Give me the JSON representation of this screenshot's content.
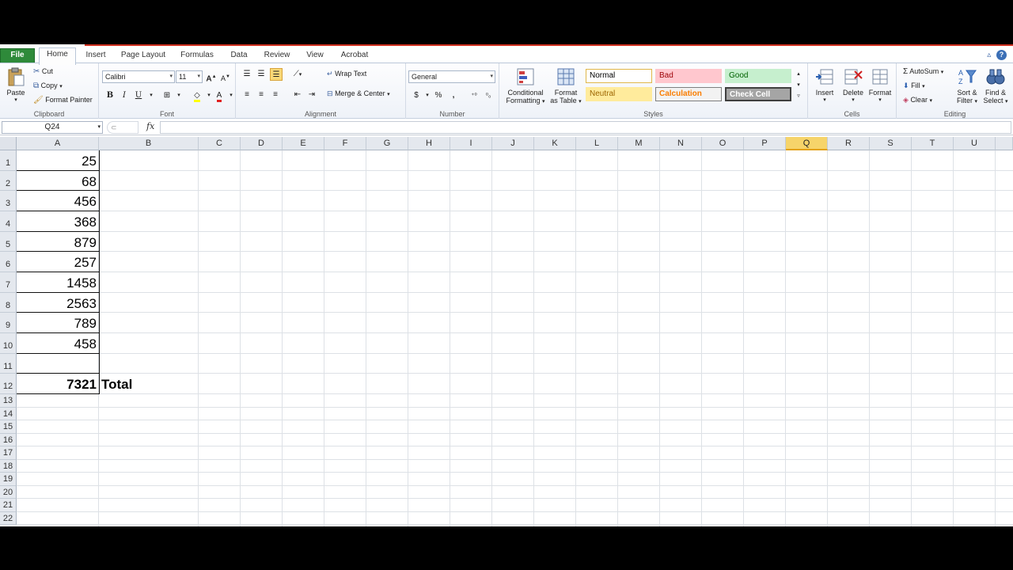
{
  "tabs": [
    "File",
    "Home",
    "Insert",
    "Page Layout",
    "Formulas",
    "Data",
    "Review",
    "View",
    "Acrobat"
  ],
  "clipboard": {
    "paste": "Paste",
    "cut": "Cut",
    "copy": "Copy",
    "format_painter": "Format Painter",
    "label": "Clipboard"
  },
  "font": {
    "name": "Calibri",
    "size": "11",
    "bold": "B",
    "italic": "I",
    "underline": "U",
    "color_letter": "A",
    "label": "Font"
  },
  "alignment": {
    "wrap": "Wrap Text",
    "merge": "Merge & Center",
    "label": "Alignment"
  },
  "number": {
    "format": "General",
    "currency": "$",
    "percent": "%",
    "comma": ",",
    "label": "Number"
  },
  "styles": {
    "conditional_1": "Conditional",
    "conditional_2": "Formatting",
    "format_table_1": "Format",
    "format_table_2": "as Table",
    "normal": "Normal",
    "bad": "Bad",
    "good": "Good",
    "neutral": "Neutral",
    "calculation": "Calculation",
    "check_cell": "Check Cell",
    "label": "Styles"
  },
  "cells": {
    "insert": "Insert",
    "delete": "Delete",
    "format": "Format",
    "label": "Cells"
  },
  "editing": {
    "autosum": "AutoSum",
    "fill": "Fill",
    "clear": "Clear",
    "sort_1": "Sort &",
    "sort_2": "Filter",
    "find_1": "Find &",
    "find_2": "Select",
    "label": "Editing"
  },
  "formula_bar": {
    "name_box": "Q24",
    "fx": "fx",
    "content": ""
  },
  "columns": [
    "A",
    "B",
    "C",
    "D",
    "E",
    "F",
    "G",
    "H",
    "I",
    "J",
    "K",
    "L",
    "M",
    "N",
    "O",
    "P",
    "Q",
    "R",
    "S",
    "T",
    "U"
  ],
  "active_column": "Q",
  "rows": [
    "1",
    "2",
    "3",
    "4",
    "5",
    "6",
    "7",
    "8",
    "9",
    "10",
    "11",
    "12",
    "13",
    "14",
    "15",
    "16",
    "17",
    "18",
    "19",
    "20",
    "21",
    "22"
  ],
  "sheet": {
    "A": [
      "25",
      "68",
      "456",
      "368",
      "879",
      "257",
      "1458",
      "2563",
      "789",
      "458",
      "",
      "7321"
    ],
    "B12": "Total"
  }
}
